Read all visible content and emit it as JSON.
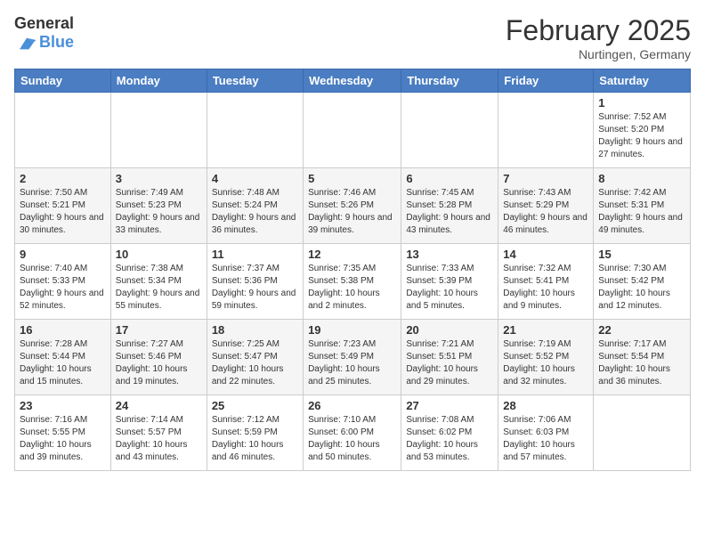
{
  "header": {
    "logo_general": "General",
    "logo_blue": "Blue",
    "month_title": "February 2025",
    "location": "Nurtingen, Germany"
  },
  "weekdays": [
    "Sunday",
    "Monday",
    "Tuesday",
    "Wednesday",
    "Thursday",
    "Friday",
    "Saturday"
  ],
  "weeks": [
    [
      {
        "day": "",
        "info": ""
      },
      {
        "day": "",
        "info": ""
      },
      {
        "day": "",
        "info": ""
      },
      {
        "day": "",
        "info": ""
      },
      {
        "day": "",
        "info": ""
      },
      {
        "day": "",
        "info": ""
      },
      {
        "day": "1",
        "info": "Sunrise: 7:52 AM\nSunset: 5:20 PM\nDaylight: 9 hours and 27 minutes."
      }
    ],
    [
      {
        "day": "2",
        "info": "Sunrise: 7:50 AM\nSunset: 5:21 PM\nDaylight: 9 hours and 30 minutes."
      },
      {
        "day": "3",
        "info": "Sunrise: 7:49 AM\nSunset: 5:23 PM\nDaylight: 9 hours and 33 minutes."
      },
      {
        "day": "4",
        "info": "Sunrise: 7:48 AM\nSunset: 5:24 PM\nDaylight: 9 hours and 36 minutes."
      },
      {
        "day": "5",
        "info": "Sunrise: 7:46 AM\nSunset: 5:26 PM\nDaylight: 9 hours and 39 minutes."
      },
      {
        "day": "6",
        "info": "Sunrise: 7:45 AM\nSunset: 5:28 PM\nDaylight: 9 hours and 43 minutes."
      },
      {
        "day": "7",
        "info": "Sunrise: 7:43 AM\nSunset: 5:29 PM\nDaylight: 9 hours and 46 minutes."
      },
      {
        "day": "8",
        "info": "Sunrise: 7:42 AM\nSunset: 5:31 PM\nDaylight: 9 hours and 49 minutes."
      }
    ],
    [
      {
        "day": "9",
        "info": "Sunrise: 7:40 AM\nSunset: 5:33 PM\nDaylight: 9 hours and 52 minutes."
      },
      {
        "day": "10",
        "info": "Sunrise: 7:38 AM\nSunset: 5:34 PM\nDaylight: 9 hours and 55 minutes."
      },
      {
        "day": "11",
        "info": "Sunrise: 7:37 AM\nSunset: 5:36 PM\nDaylight: 9 hours and 59 minutes."
      },
      {
        "day": "12",
        "info": "Sunrise: 7:35 AM\nSunset: 5:38 PM\nDaylight: 10 hours and 2 minutes."
      },
      {
        "day": "13",
        "info": "Sunrise: 7:33 AM\nSunset: 5:39 PM\nDaylight: 10 hours and 5 minutes."
      },
      {
        "day": "14",
        "info": "Sunrise: 7:32 AM\nSunset: 5:41 PM\nDaylight: 10 hours and 9 minutes."
      },
      {
        "day": "15",
        "info": "Sunrise: 7:30 AM\nSunset: 5:42 PM\nDaylight: 10 hours and 12 minutes."
      }
    ],
    [
      {
        "day": "16",
        "info": "Sunrise: 7:28 AM\nSunset: 5:44 PM\nDaylight: 10 hours and 15 minutes."
      },
      {
        "day": "17",
        "info": "Sunrise: 7:27 AM\nSunset: 5:46 PM\nDaylight: 10 hours and 19 minutes."
      },
      {
        "day": "18",
        "info": "Sunrise: 7:25 AM\nSunset: 5:47 PM\nDaylight: 10 hours and 22 minutes."
      },
      {
        "day": "19",
        "info": "Sunrise: 7:23 AM\nSunset: 5:49 PM\nDaylight: 10 hours and 25 minutes."
      },
      {
        "day": "20",
        "info": "Sunrise: 7:21 AM\nSunset: 5:51 PM\nDaylight: 10 hours and 29 minutes."
      },
      {
        "day": "21",
        "info": "Sunrise: 7:19 AM\nSunset: 5:52 PM\nDaylight: 10 hours and 32 minutes."
      },
      {
        "day": "22",
        "info": "Sunrise: 7:17 AM\nSunset: 5:54 PM\nDaylight: 10 hours and 36 minutes."
      }
    ],
    [
      {
        "day": "23",
        "info": "Sunrise: 7:16 AM\nSunset: 5:55 PM\nDaylight: 10 hours and 39 minutes."
      },
      {
        "day": "24",
        "info": "Sunrise: 7:14 AM\nSunset: 5:57 PM\nDaylight: 10 hours and 43 minutes."
      },
      {
        "day": "25",
        "info": "Sunrise: 7:12 AM\nSunset: 5:59 PM\nDaylight: 10 hours and 46 minutes."
      },
      {
        "day": "26",
        "info": "Sunrise: 7:10 AM\nSunset: 6:00 PM\nDaylight: 10 hours and 50 minutes."
      },
      {
        "day": "27",
        "info": "Sunrise: 7:08 AM\nSunset: 6:02 PM\nDaylight: 10 hours and 53 minutes."
      },
      {
        "day": "28",
        "info": "Sunrise: 7:06 AM\nSunset: 6:03 PM\nDaylight: 10 hours and 57 minutes."
      },
      {
        "day": "",
        "info": ""
      }
    ]
  ]
}
